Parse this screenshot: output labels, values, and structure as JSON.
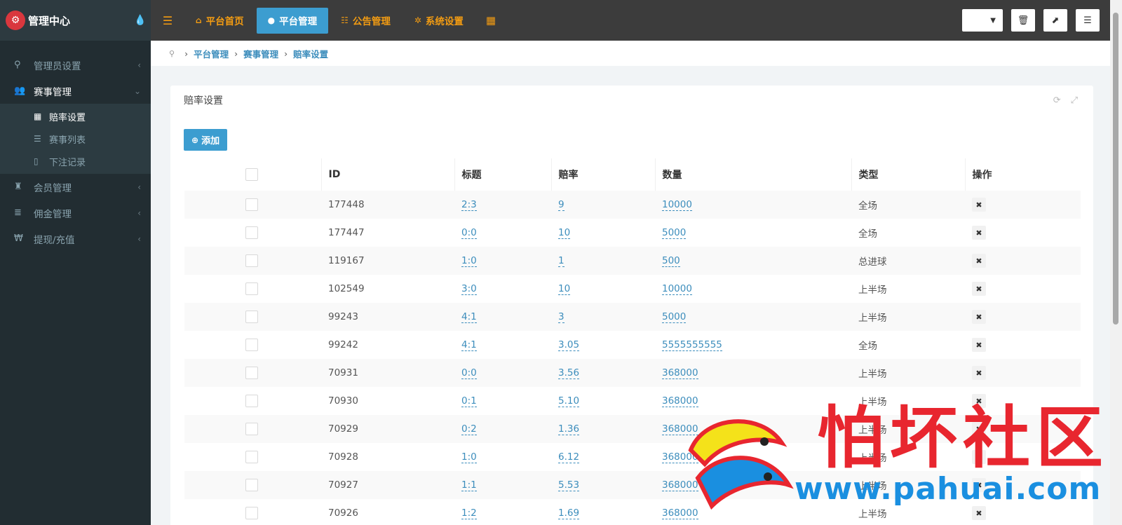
{
  "sidebar": {
    "brand": "管理中心",
    "logo_icon": "gear-logo-icon",
    "menu": [
      {
        "label": "管理员设置",
        "icon": "key-icon"
      },
      {
        "label": "赛事管理",
        "icon": "users-icon",
        "open": true,
        "children": [
          {
            "label": "赔率设置",
            "icon": "grid-icon",
            "active": true
          },
          {
            "label": "赛事列表",
            "icon": "list-icon"
          },
          {
            "label": "下注记录",
            "icon": "file-icon"
          }
        ]
      },
      {
        "label": "会员管理",
        "icon": "trophy-icon"
      },
      {
        "label": "佣金管理",
        "icon": "database-icon"
      },
      {
        "label": "提现/充值",
        "icon": "won-icon"
      }
    ]
  },
  "topbar": {
    "tabs": [
      {
        "label": "平台首页",
        "icon": "home-icon",
        "active": false
      },
      {
        "label": "平台管理",
        "icon": "user-icon",
        "active": true
      },
      {
        "label": "公告管理",
        "icon": "list-icon",
        "active": false
      },
      {
        "label": "系统设置",
        "icon": "cog-icon",
        "active": false
      }
    ]
  },
  "breadcrumb": [
    "平台管理",
    "赛事管理",
    "赔率设置"
  ],
  "panel": {
    "title": "赔率设置",
    "add_label": "添加",
    "columns": [
      "ID",
      "标题",
      "赔率",
      "数量",
      "类型",
      "操作"
    ],
    "rows": [
      {
        "id": "177448",
        "title": "2:3",
        "odds": "9",
        "qty": "10000",
        "type": "全场"
      },
      {
        "id": "177447",
        "title": "0:0",
        "odds": "10",
        "qty": "5000",
        "type": "全场"
      },
      {
        "id": "119167",
        "title": "1:0",
        "odds": "1",
        "qty": "500",
        "type": "总进球"
      },
      {
        "id": "102549",
        "title": "3:0",
        "odds": "10",
        "qty": "10000",
        "type": "上半场"
      },
      {
        "id": "99243",
        "title": "4:1",
        "odds": "3",
        "qty": "5000",
        "type": "上半场"
      },
      {
        "id": "99242",
        "title": "4:1",
        "odds": "3.05",
        "qty": "5555555555",
        "type": "全场"
      },
      {
        "id": "70931",
        "title": "0:0",
        "odds": "3.56",
        "qty": "368000",
        "type": "上半场"
      },
      {
        "id": "70930",
        "title": "0:1",
        "odds": "5.10",
        "qty": "368000",
        "type": "上半场"
      },
      {
        "id": "70929",
        "title": "0:2",
        "odds": "1.36",
        "qty": "368000",
        "type": "上半场"
      },
      {
        "id": "70928",
        "title": "1:0",
        "odds": "6.12",
        "qty": "368000",
        "type": "上半场"
      },
      {
        "id": "70927",
        "title": "1:1",
        "odds": "5.53",
        "qty": "368000",
        "type": "上半场"
      },
      {
        "id": "70926",
        "title": "1:2",
        "odds": "1.69",
        "qty": "368000",
        "type": "上半场"
      }
    ]
  },
  "watermark": {
    "text": "怕坏社区",
    "url": "www.pahuai.com"
  },
  "colors": {
    "sidebar_bg": "#222d32",
    "topbar_bg": "#3c3c3c",
    "accent_orange": "#f39c12",
    "accent_blue": "#3c9dd0",
    "link_blue": "#3c8dbc"
  }
}
